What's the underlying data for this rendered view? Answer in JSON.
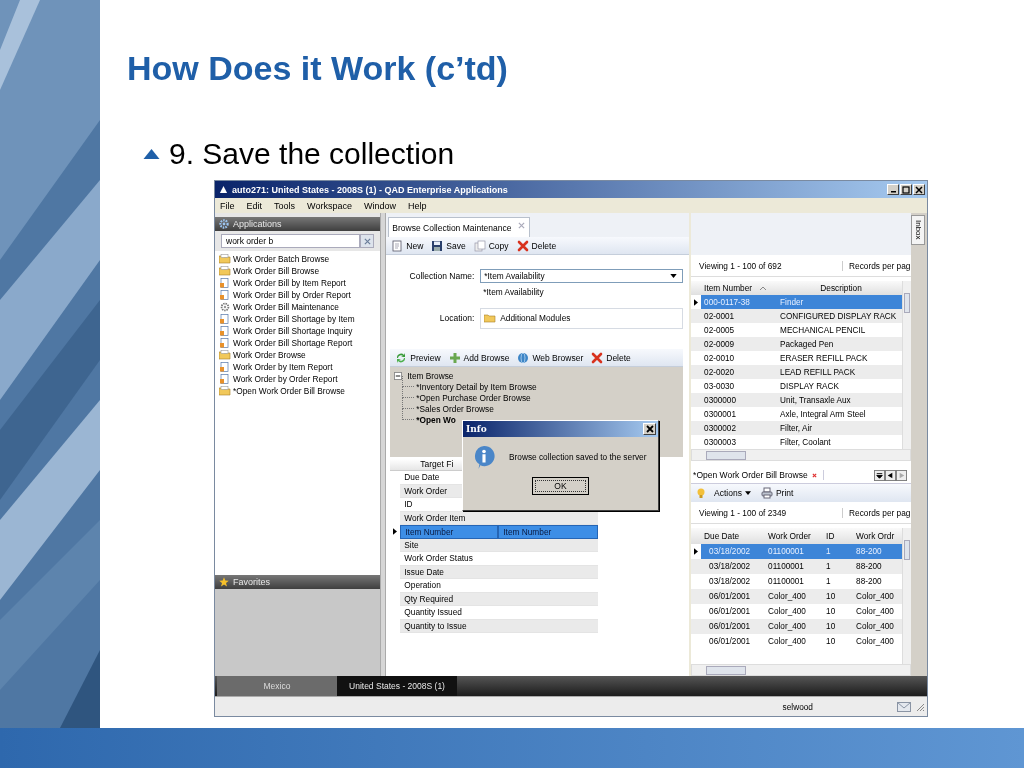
{
  "slide": {
    "title": "How Does it Work (c’td)",
    "bullet": "9. Save the collection"
  },
  "window": {
    "title": "auto271: United States - 2008S (1) - QAD Enterprise Applications",
    "menu": [
      "File",
      "Edit",
      "Tools",
      "Workspace",
      "Window",
      "Help"
    ]
  },
  "applications": {
    "header": "Applications",
    "search": "work order b",
    "items": [
      {
        "label": "Work Order Batch Browse",
        "kind": "browse"
      },
      {
        "label": "Work Order Bill Browse",
        "kind": "browse"
      },
      {
        "label": "Work Order Bill by Item Report",
        "kind": "report"
      },
      {
        "label": "Work Order Bill by Order Report",
        "kind": "report"
      },
      {
        "label": "Work Order Bill Maintenance",
        "kind": "maintenance"
      },
      {
        "label": "Work Order Bill Shortage by Item",
        "kind": "report"
      },
      {
        "label": "Work Order Bill Shortage Inquiry",
        "kind": "report"
      },
      {
        "label": "Work Order Bill Shortage Report",
        "kind": "report"
      },
      {
        "label": "Work Order Browse",
        "kind": "browse"
      },
      {
        "label": "Work Order by Item Report",
        "kind": "report"
      },
      {
        "label": "Work Order by Order Report",
        "kind": "report"
      },
      {
        "label": "*Open Work Order Bill Browse",
        "kind": "browse"
      }
    ]
  },
  "favorites": {
    "header": "Favorites"
  },
  "center_tab": {
    "label": "Browse Collection Maintenance"
  },
  "toolbar": [
    {
      "label": "New",
      "kind": "new"
    },
    {
      "label": "Save",
      "kind": "save"
    },
    {
      "label": "Copy",
      "kind": "copy"
    },
    {
      "label": "Delete",
      "kind": "delete"
    }
  ],
  "form": {
    "collection_label": "Collection Name:",
    "collection_value": "*Item Availability",
    "collection_hint": "*Item Availability",
    "location_label": "Location:",
    "location_value": "Additional Modules"
  },
  "browse_toolbar": [
    {
      "label": "Preview",
      "kind": "preview"
    },
    {
      "label": "Add Browse",
      "kind": "add"
    },
    {
      "label": "Web Browser",
      "kind": "web"
    },
    {
      "label": "Delete",
      "kind": "delete"
    }
  ],
  "tree": {
    "label": "Item Browse",
    "expanded": true,
    "children": [
      {
        "label": "*Inventory Detail by Item Browse",
        "active": false
      },
      {
        "label": "*Open Purchase Order Browse",
        "active": false
      },
      {
        "label": "*Sales Order Browse",
        "active": false
      },
      {
        "label": "*Open Wo",
        "active": true
      }
    ]
  },
  "target_grid": {
    "header": "Target Fi",
    "rows": [
      {
        "field": "Due Date",
        "selected": false
      },
      {
        "field": "Work Order",
        "selected": false
      },
      {
        "field": "ID",
        "selected": false
      },
      {
        "field": "Work Order Item",
        "selected": false
      },
      {
        "field": "Item Number",
        "target": "Item Number",
        "selected": true
      },
      {
        "field": "Site",
        "selected": false
      },
      {
        "field": "Work Order Status",
        "selected": false
      },
      {
        "field": "Issue Date",
        "selected": false
      },
      {
        "field": "Operation",
        "selected": false
      },
      {
        "field": "Qty Required",
        "selected": false
      },
      {
        "field": "Quantity Issued",
        "selected": false
      },
      {
        "field": "Quantity to Issue",
        "selected": false
      }
    ]
  },
  "item_grid": {
    "viewing": "Viewing 1 - 100  of  692",
    "records": "Records per pag",
    "columns": [
      "Item Number",
      "Description"
    ],
    "rows": [
      {
        "cells": [
          "000-0117-38",
          "Finder"
        ],
        "selected": true
      },
      {
        "cells": [
          "02-0001",
          "CONFIGURED DISPLAY RACK"
        ],
        "selected": false
      },
      {
        "cells": [
          "02-0005",
          "MECHANICAL PENCIL"
        ],
        "selected": false
      },
      {
        "cells": [
          "02-0009",
          "Packaged Pen"
        ],
        "selected": false
      },
      {
        "cells": [
          "02-0010",
          "ERASER REFILL PACK"
        ],
        "selected": false
      },
      {
        "cells": [
          "02-0020",
          "LEAD REFILL PACK"
        ],
        "selected": false
      },
      {
        "cells": [
          "03-0030",
          "DISPLAY RACK"
        ],
        "selected": false
      },
      {
        "cells": [
          "0300000",
          "Unit, Transaxle Aux"
        ],
        "selected": false
      },
      {
        "cells": [
          "0300001",
          "Axle, Integral Arm Steel"
        ],
        "selected": false
      },
      {
        "cells": [
          "0300002",
          "Filter, Air"
        ],
        "selected": false
      },
      {
        "cells": [
          "0300003",
          "Filter, Coolant"
        ],
        "selected": false
      }
    ]
  },
  "wo_tab": {
    "label": "*Open Work Order Bill Browse",
    "actions": "Actions",
    "print": "Print"
  },
  "wo_grid": {
    "viewing": "Viewing 1 - 100  of  2349",
    "records": "Records per pag",
    "columns": [
      "Due Date",
      "Work Order",
      "ID",
      "Work Ordr"
    ],
    "rows": [
      {
        "cells": [
          "03/18/2002",
          "01100001",
          "1",
          "88-200"
        ],
        "selected": true
      },
      {
        "cells": [
          "03/18/2002",
          "01100001",
          "1",
          "88-200"
        ],
        "selected": false
      },
      {
        "cells": [
          "03/18/2002",
          "01100001",
          "1",
          "88-200"
        ],
        "selected": false
      },
      {
        "cells": [
          "06/01/2001",
          "Color_400",
          "10",
          "Color_400"
        ],
        "selected": false
      },
      {
        "cells": [
          "06/01/2001",
          "Color_400",
          "10",
          "Color_400"
        ],
        "selected": false
      },
      {
        "cells": [
          "06/01/2001",
          "Color_400",
          "10",
          "Color_400"
        ],
        "selected": false
      },
      {
        "cells": [
          "06/01/2001",
          "Color_400",
          "10",
          "Color_400"
        ],
        "selected": false
      }
    ]
  },
  "inbox": "Inbox",
  "taskbar": [
    {
      "label": "Mexico",
      "selected": false
    },
    {
      "label": "United States - 2008S (1)",
      "selected": true
    }
  ],
  "status": "selwood",
  "dialog": {
    "title": "Info",
    "message": "Browse collection saved to the server",
    "button": "OK"
  }
}
